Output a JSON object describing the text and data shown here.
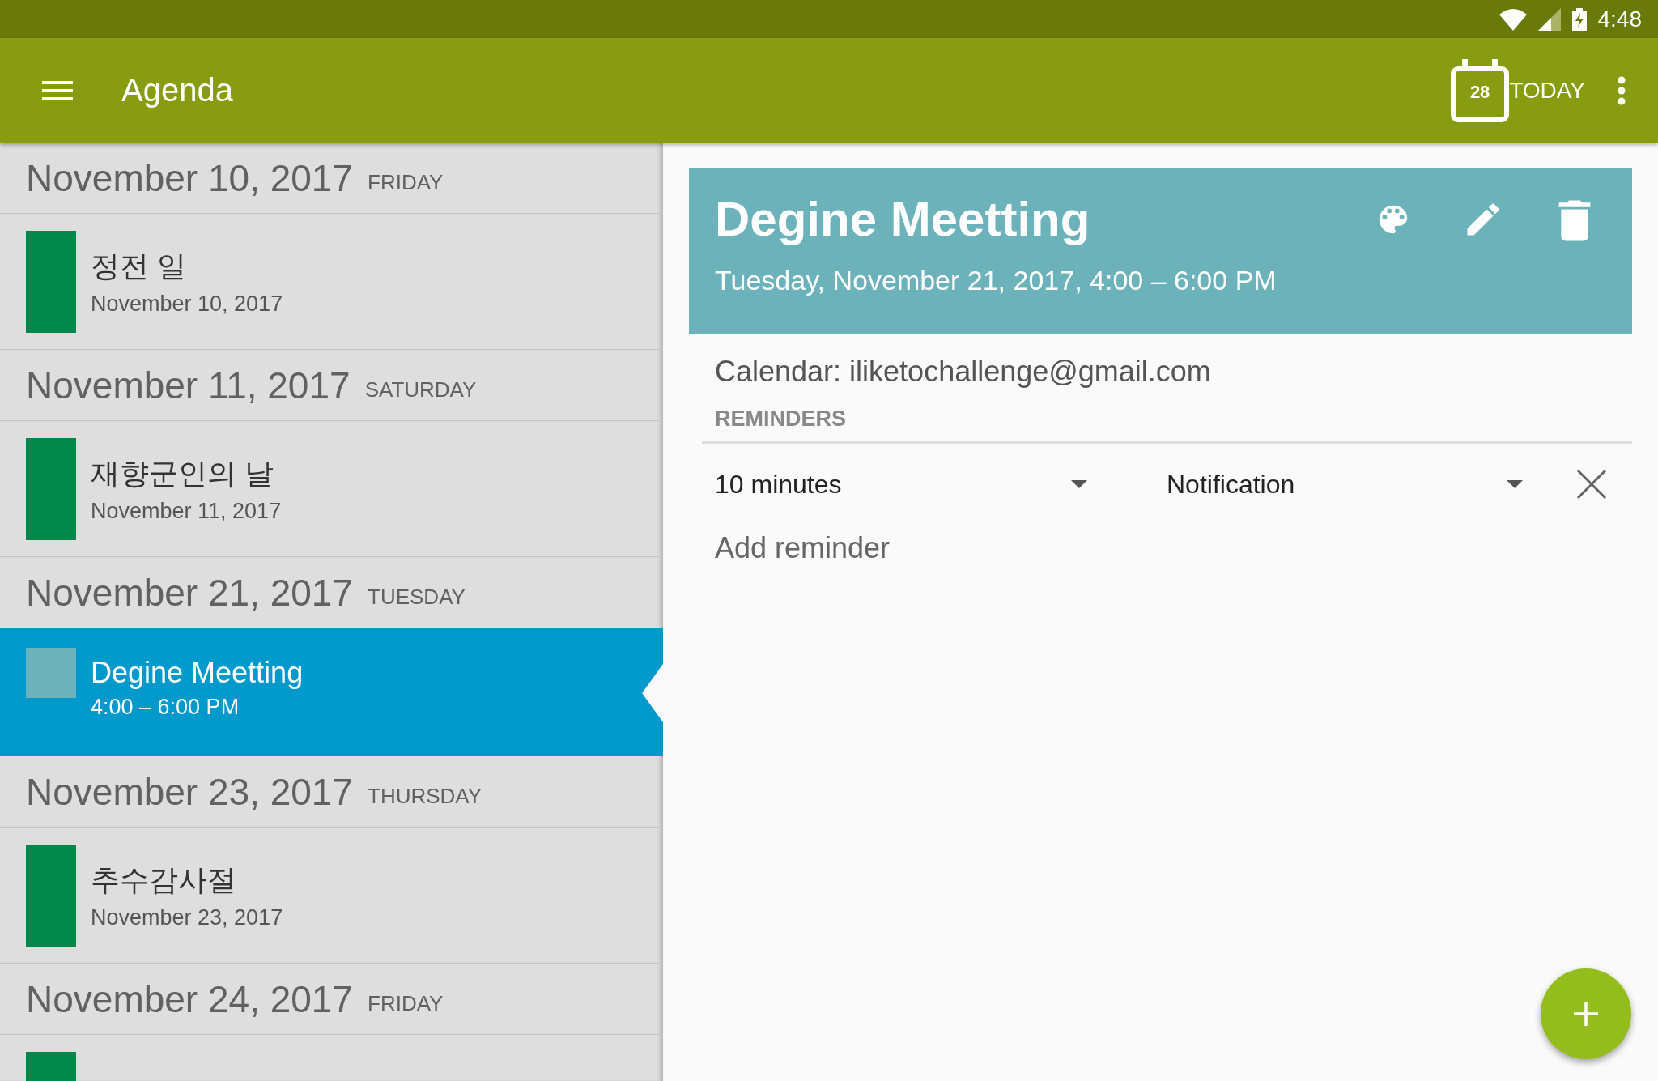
{
  "status_bar": {
    "time": "4:48"
  },
  "app_bar": {
    "title": "Agenda",
    "today_date": "28",
    "today_label": "TODAY"
  },
  "agenda": [
    {
      "date": "November 10, 2017",
      "weekday": "FRIDAY",
      "events": [
        {
          "title": "정전 일",
          "subtitle": "November 10, 2017",
          "color": "#00874a",
          "selected": false
        }
      ]
    },
    {
      "date": "November 11, 2017",
      "weekday": "SATURDAY",
      "events": [
        {
          "title": "재향군인의 날",
          "subtitle": "November 11, 2017",
          "color": "#00874a",
          "selected": false
        }
      ]
    },
    {
      "date": "November 21, 2017",
      "weekday": "TUESDAY",
      "events": [
        {
          "title": "Degine Meetting",
          "subtitle": "4:00 – 6:00 PM",
          "color": "#6bb2ba",
          "selected": true
        }
      ]
    },
    {
      "date": "November 23, 2017",
      "weekday": "THURSDAY",
      "events": [
        {
          "title": "추수감사절",
          "subtitle": "November 23, 2017",
          "color": "#00874a",
          "selected": false
        }
      ]
    },
    {
      "date": "November 24, 2017",
      "weekday": "FRIDAY",
      "events": [
        {
          "color": "#00874a",
          "selected": false
        }
      ]
    }
  ],
  "detail": {
    "title": "Degine Meetting",
    "when": "Tuesday, November 21, 2017, 4:00 – 6:00 PM",
    "color": "#6bb2ba",
    "calendar": "Calendar: iliketochallenge@gmail.com",
    "reminders_label": "REMINDERS",
    "reminders": [
      {
        "time": "10 minutes",
        "method": "Notification"
      }
    ],
    "add_reminder": "Add reminder"
  }
}
